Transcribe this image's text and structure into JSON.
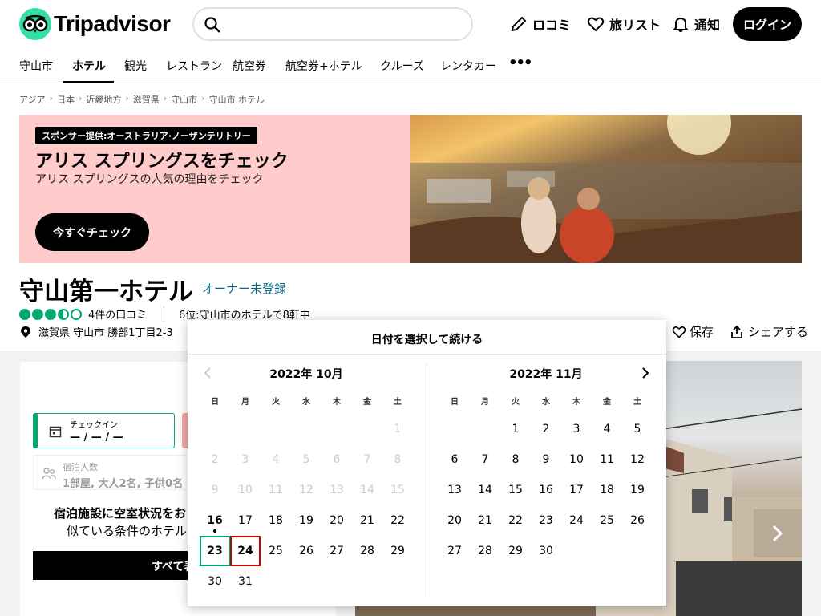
{
  "header": {
    "logo_text": "Tripadvisor",
    "search_placeholder": "",
    "nav": [
      {
        "label": "ロコミ",
        "icon": "pencil-icon"
      },
      {
        "label": "旅リスト",
        "icon": "heart-icon"
      },
      {
        "label": "通知",
        "icon": "bell-icon"
      }
    ],
    "login_label": "ログイン"
  },
  "tabs": [
    "守山市",
    "ホテル",
    "観光",
    "レストラン",
    "航空券",
    "航空券+ホテル",
    "クルーズ",
    "レンタカー",
    "•••"
  ],
  "active_tab": 1,
  "breadcrumbs": [
    "アジア",
    "日本",
    "近畿地方",
    "滋賀県",
    "守山市",
    "守山市 ホテル"
  ],
  "banner": {
    "sponsor": "スポンサー提供:オーストラリア·ノーザンテリトリー",
    "title": "アリス スプリングスをチェック",
    "subtitle": "アリス スプリングスの人気の理由をチェック",
    "button": "今すぐチェック"
  },
  "hotel": {
    "name": "守山第一ホテル",
    "owner_link": "オーナー未登録",
    "rating": 3.5,
    "reviews": "4件の口コミ",
    "rank": "6位:守山市のホテルで8軒中",
    "address": "滋賀県 守山市 勝部1丁目2-3",
    "save": "保存",
    "share": "シェアする"
  },
  "booking": {
    "checkin_label": "チェックイン",
    "checkin_value": "— / — / —",
    "guests_label": "宿泊人数",
    "guests_value": "1部屋, 大人2名, 子供0名",
    "avail_title": "宿泊施設に空室状況をお",
    "avail_sub": "似ている条件のホテル",
    "all_button": "すべて表"
  },
  "calendar": {
    "title": "日付を選択して続ける",
    "weekdays": [
      "日",
      "月",
      "火",
      "水",
      "木",
      "金",
      "土"
    ],
    "months": [
      {
        "label": "2022年 10月",
        "first_weekday": 6,
        "days": 31,
        "today": 16,
        "start": 23,
        "end": 24
      },
      {
        "label": "2022年 11月",
        "first_weekday": 2,
        "days": 30
      }
    ]
  }
}
